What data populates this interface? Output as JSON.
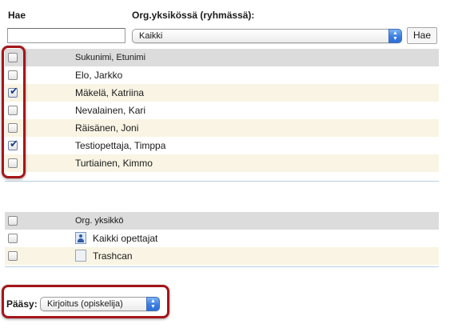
{
  "search": {
    "label": "Hae",
    "value": "",
    "placeholder": ""
  },
  "org_filter": {
    "label": "Org.yksikössä (ryhmässä):",
    "selected": "Kaikki"
  },
  "search_button": "Hae",
  "users_table": {
    "header": "Sukunimi, Etunimi",
    "rows": [
      {
        "name": "Elo, Jarkko",
        "checked": false
      },
      {
        "name": "Mäkelä, Katriina",
        "checked": true
      },
      {
        "name": "Nevalainen, Kari",
        "checked": false
      },
      {
        "name": "Räisänen, Joni",
        "checked": false
      },
      {
        "name": "Testiopettaja, Timppa",
        "checked": true
      },
      {
        "name": "Turtiainen, Kimmo",
        "checked": false
      }
    ]
  },
  "units_table": {
    "header": "Org. yksikkö",
    "rows": [
      {
        "name": "Kaikki opettajat",
        "icon": "group-person-icon",
        "checked": false
      },
      {
        "name": "Trashcan",
        "icon": "folder-icon",
        "checked": false
      }
    ]
  },
  "access": {
    "label": "Pääsy:",
    "selected": "Kirjoitus (opiskelija)"
  },
  "colors": {
    "highlight": "#a4161a",
    "alt_row": "#f9f4e3",
    "header_row": "#dcdcdc",
    "checkmark": "#1d3e8c"
  }
}
